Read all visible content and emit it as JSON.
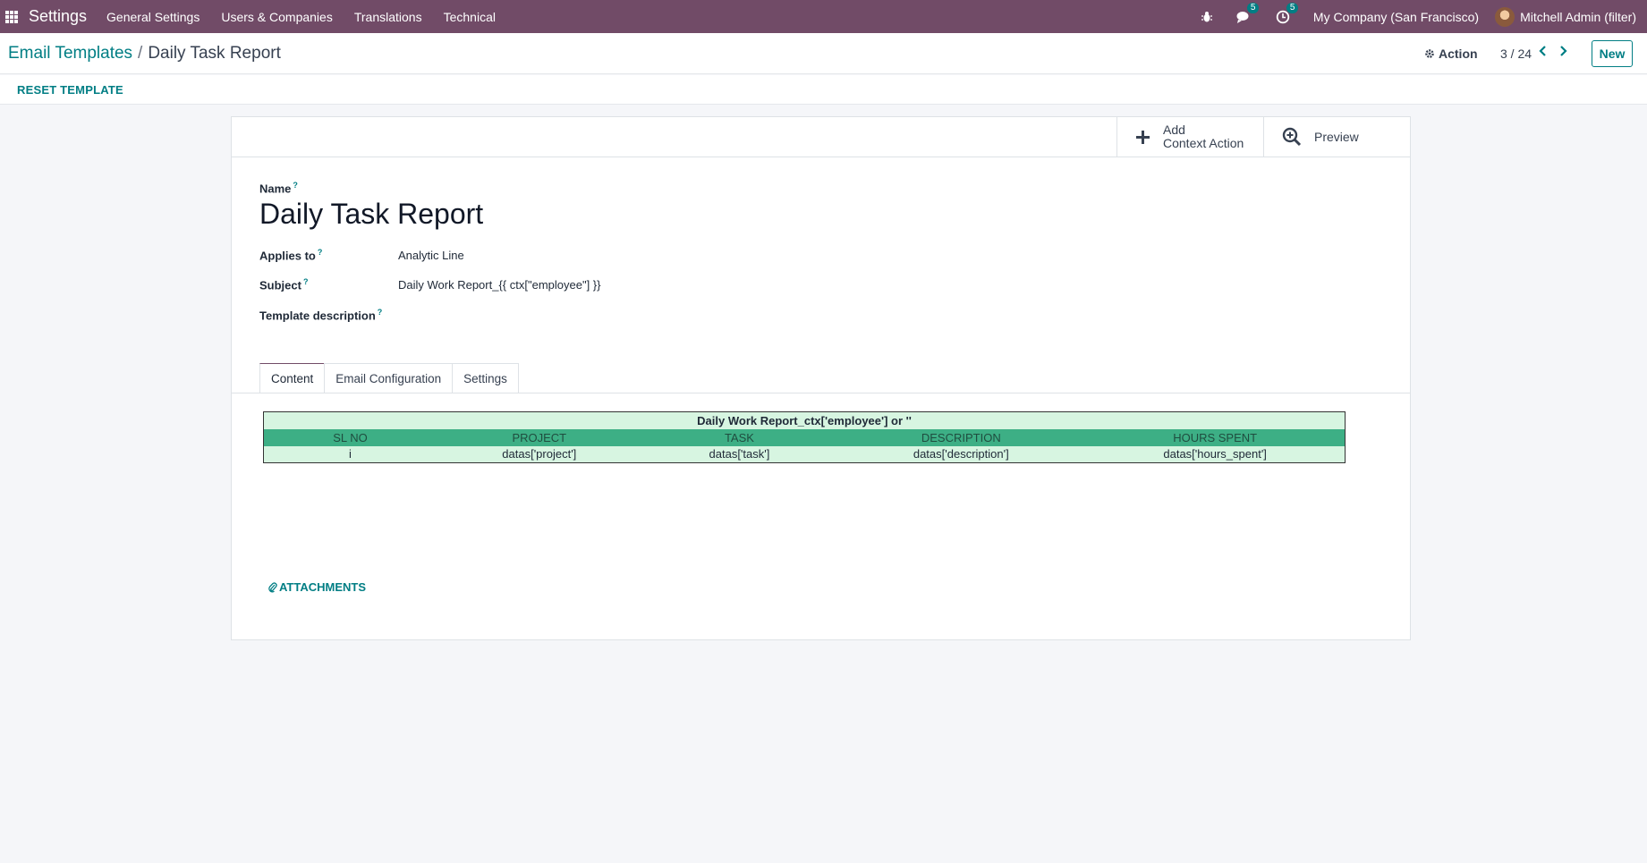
{
  "navbar": {
    "app_name": "Settings",
    "menu": [
      "General Settings",
      "Users & Companies",
      "Translations",
      "Technical"
    ],
    "messages_count": "5",
    "activities_count": "5",
    "company": "My Company (San Francisco)",
    "user": "Mitchell Admin (filter)",
    "bg_color": "#714b67"
  },
  "control_panel": {
    "breadcrumb_parent": "Email Templates",
    "breadcrumb_sep": "/",
    "breadcrumb_current": "Daily Task Report",
    "action_label": "Action",
    "pager": "3 / 24",
    "new_label": "New"
  },
  "statusbar": {
    "reset_label": "RESET TEMPLATE"
  },
  "button_box": {
    "add_line1": "Add",
    "add_line2": "Context Action",
    "preview_label": "Preview"
  },
  "form": {
    "name_label": "Name",
    "help_mark": "?",
    "name_value": "Daily Task Report",
    "applies_to_label": "Applies to",
    "applies_to_value": "Analytic Line",
    "subject_label": "Subject",
    "subject_value": "Daily Work Report_{{ ctx[\"employee\"] }}",
    "template_description_label": "Template description"
  },
  "tabs": [
    "Content",
    "Email Configuration",
    "Settings"
  ],
  "content_table": {
    "title": "Daily Work Report_ctx['employee'] or ''",
    "headers": [
      "SL NO",
      "PROJECT",
      "TASK",
      "DESCRIPTION",
      "HOURS SPENT"
    ],
    "row": [
      "i",
      "datas['project']",
      "datas['task']",
      "datas['description']",
      "datas['hours_spent']"
    ]
  },
  "attachments_label": "ATTACHMENTS",
  "accent_color": "#017e84"
}
